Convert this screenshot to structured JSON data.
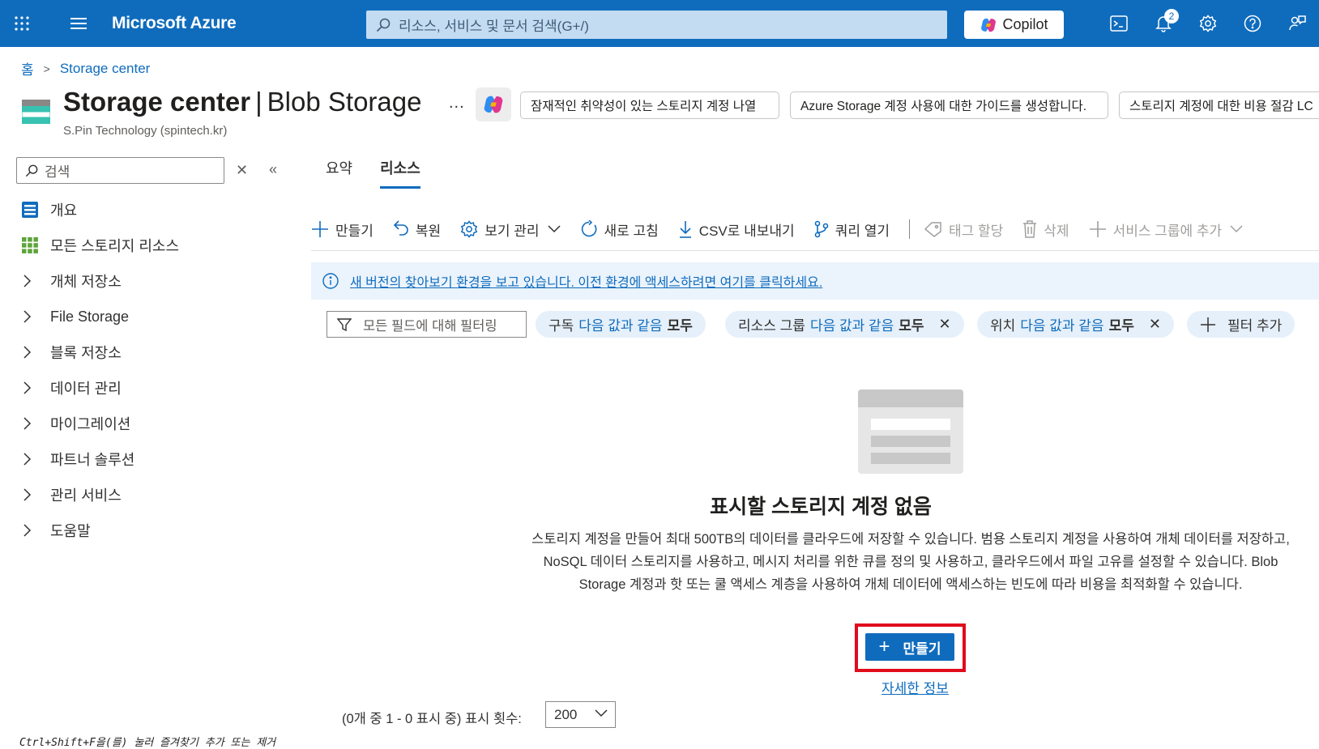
{
  "topbar": {
    "brand": "Microsoft Azure",
    "search_placeholder": "리소스, 서비스 및 문서 검색(G+/)",
    "copilot_label": "Copilot",
    "notification_count": "2"
  },
  "breadcrumb": {
    "home": "홈",
    "current": "Storage center"
  },
  "header": {
    "title_main": "Storage center",
    "title_sep": "|",
    "title_sub": "Blob Storage",
    "subtitle": "S.Pin Technology (spintech.kr)",
    "more": "...",
    "suggestions": [
      "잠재적인 취약성이 있는 스토리지 계정 나열",
      "Azure Storage 계정 사용에 대한 가이드를 생성합니다.",
      "스토리지 계정에 대한 비용 절감 LC"
    ]
  },
  "sidebar": {
    "search_placeholder": "검색",
    "items": [
      {
        "label": "개요",
        "icon": "overview-icon"
      },
      {
        "label": "모든 스토리지 리소스",
        "icon": "grid-icon"
      },
      {
        "label": "개체 저장소",
        "icon": "chevron-right-icon"
      },
      {
        "label": "File Storage",
        "icon": "chevron-right-icon"
      },
      {
        "label": "블록 저장소",
        "icon": "chevron-right-icon"
      },
      {
        "label": "데이터 관리",
        "icon": "chevron-right-icon"
      },
      {
        "label": "마이그레이션",
        "icon": "chevron-right-icon"
      },
      {
        "label": "파트너 솔루션",
        "icon": "chevron-right-icon"
      },
      {
        "label": "관리 서비스",
        "icon": "chevron-right-icon"
      },
      {
        "label": "도움말",
        "icon": "chevron-right-icon"
      }
    ]
  },
  "tabs": [
    {
      "label": "요약",
      "active": false
    },
    {
      "label": "리소스",
      "active": true
    }
  ],
  "toolbar": {
    "create": "만들기",
    "restore": "복원",
    "manage_view": "보기 관리",
    "refresh": "새로 고침",
    "export_csv": "CSV로 내보내기",
    "open_query": "쿼리 열기",
    "assign_tags": "태그 할당",
    "delete": "삭제",
    "add_to_service_group": "서비스 그룹에 추가"
  },
  "banner": {
    "text": "새 버전의 찾아보기 환경을 보고 있습니다. 이전 환경에 액세스하려면 여기를 클릭하세요."
  },
  "filters": {
    "placeholder": "모든 필드에 대해 필터링",
    "pills": [
      {
        "field": "구독",
        "op": "다음 값과 같음",
        "value": "모두",
        "removable": false
      },
      {
        "field": "리소스 그룹",
        "op": "다음 값과 같음",
        "value": "모두",
        "removable": true
      },
      {
        "field": "위치",
        "op": "다음 값과 같음",
        "value": "모두",
        "removable": true
      }
    ],
    "add_filter": "필터 추가"
  },
  "empty_state": {
    "title": "표시할 스토리지 계정 없음",
    "description": "스토리지 계정을 만들어 최대 500TB의 데이터를 클라우드에 저장할 수 있습니다. 범용 스토리지 계정을 사용하여 개체 데이터를 저장하고, NoSQL 데이터 스토리지를 사용하고, 메시지 처리를 위한 큐를 정의 및 사용하고, 클라우드에서 파일 고유를 설정할 수 있습니다. Blob Storage 계정과 핫 또는 쿨 액세스 계층을 사용하여 개체 데이터에 액세스하는 빈도에 따라 비용을 최적화할 수 있습니다.",
    "create_button": "만들기",
    "learn_more": "자세한 정보"
  },
  "footer": {
    "paging_text": "(0개 중 1 - 0 표시 중) 표시 횟수:",
    "page_size": "200",
    "hint": "Ctrl+Shift+F을(를) 눌러 즐겨찾기 추가 또는 제거"
  },
  "colors": {
    "accent": "#0f6cbd",
    "highlight": "#e00b1c",
    "banner_bg": "#ebf3fc",
    "pill_bg": "#e6f0fa"
  }
}
